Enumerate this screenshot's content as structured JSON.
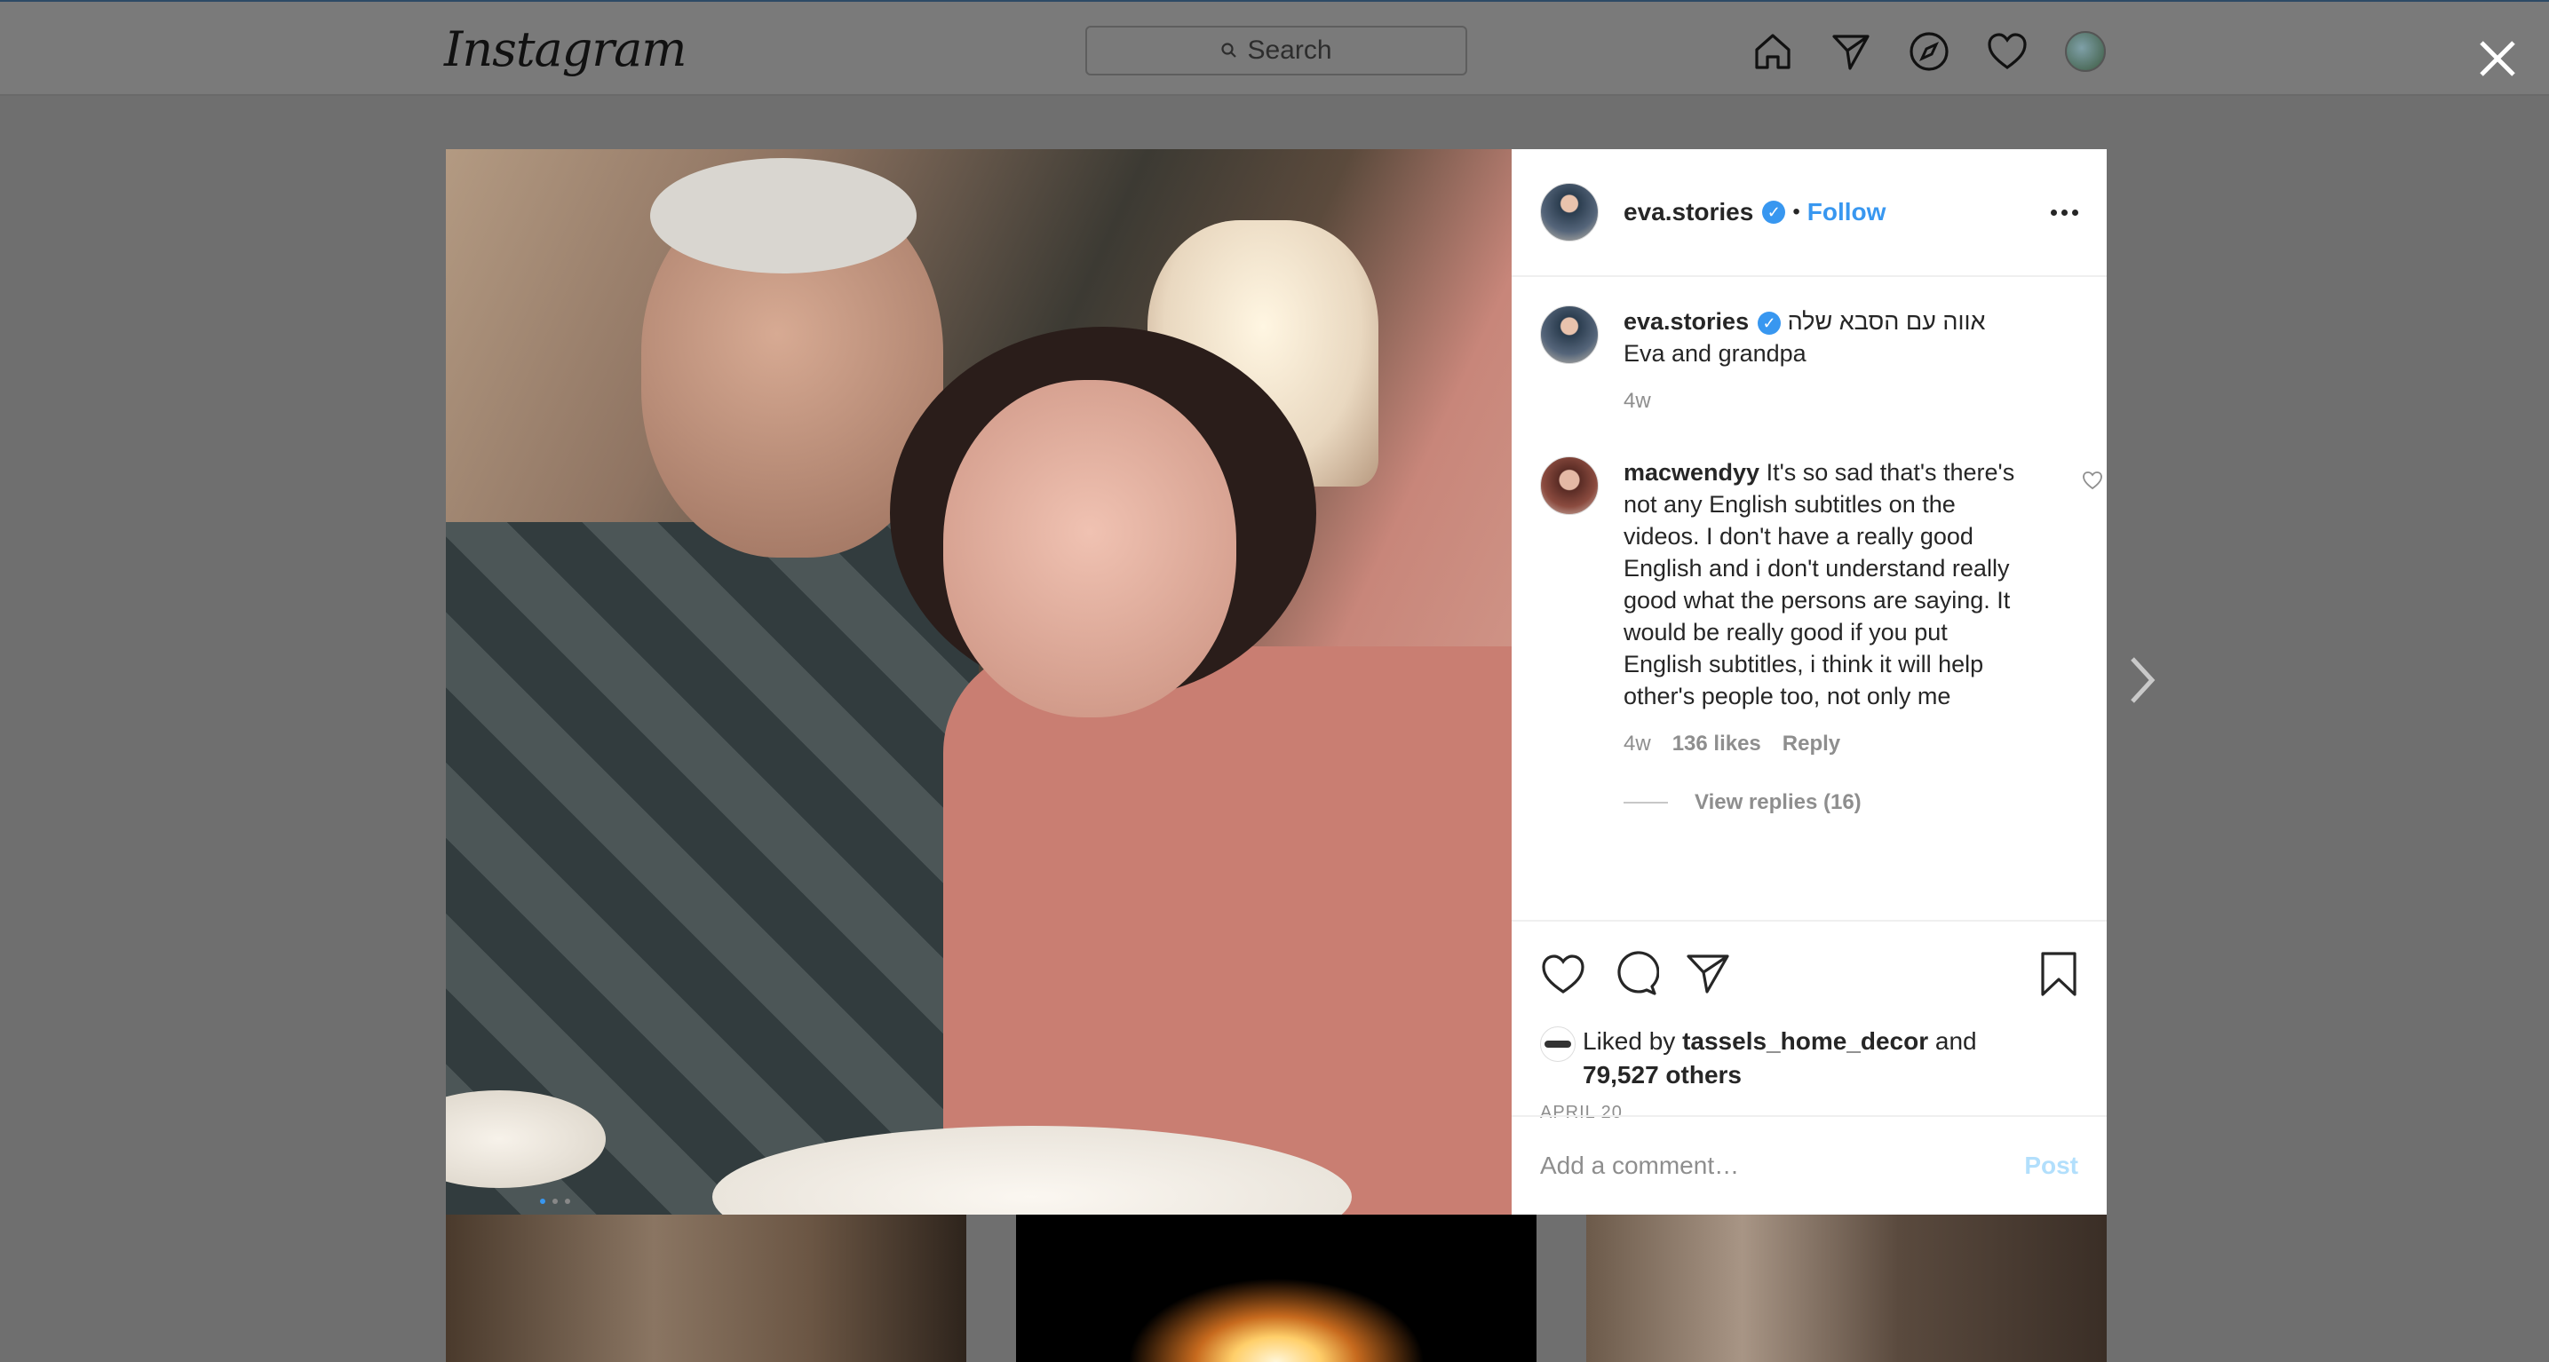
{
  "header": {
    "logo": "Instagram",
    "search_placeholder": "Search",
    "nav_icons": [
      "home-icon",
      "direct-icon",
      "explore-icon",
      "activity-heart-icon",
      "profile-avatar"
    ]
  },
  "post": {
    "username": "eva.stories",
    "follow_label": "Follow",
    "separator": "•",
    "caption_line1": "אווה עם הסבא שלה",
    "caption_line2": "Eva and grandpa",
    "caption_time": "4w",
    "comment": {
      "username": "macwendyy",
      "text": "It's so sad that's there's not any English subtitles on the videos. I don't have a really good English and i don't understand really good what the persons are saying. It would be really good if you put English subtitles, i think it will help other's people too, not only me",
      "time": "4w",
      "likes": "136 likes",
      "reply": "Reply",
      "view_replies": "View replies (16)"
    },
    "liked_by_prefix": "Liked by",
    "liked_by_user": "tassels_home_decor",
    "liked_by_and": "and",
    "liked_by_others": "79,527 others",
    "date": "APRIL 20",
    "add_comment_placeholder": "Add a comment…",
    "post_button": "Post"
  },
  "colors": {
    "accent": "#3897f0",
    "post_disabled": "#b2dffc",
    "muted": "#8e8e8e"
  }
}
